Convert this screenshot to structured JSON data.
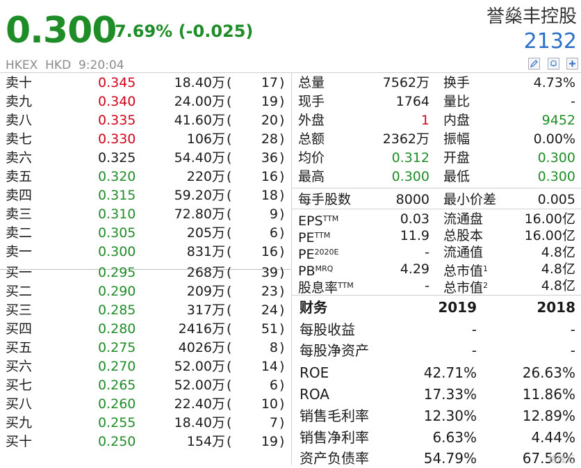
{
  "quote": {
    "price": "0.300",
    "change": "-7.69% (-0.025)",
    "exchange": "HKEX",
    "currency": "HKD",
    "time": "9:20:04",
    "name": "誉燊丰控股",
    "code": "2132"
  },
  "toolbar": {
    "icons": [
      "pencil-icon",
      "bell-icon",
      "plus-icon"
    ]
  },
  "colors": {
    "up": "#d0021b",
    "down": "#1e8c27",
    "neutral": "#1a1a1a",
    "code": "#2a6fc9"
  },
  "asks": [
    {
      "label": "卖十",
      "price": "0.345",
      "vol": "18.40万",
      "count": "17",
      "tone": "up"
    },
    {
      "label": "卖九",
      "price": "0.340",
      "vol": "24.00万",
      "count": "19",
      "tone": "up"
    },
    {
      "label": "卖八",
      "price": "0.335",
      "vol": "41.60万",
      "count": "20",
      "tone": "up"
    },
    {
      "label": "卖七",
      "price": "0.330",
      "vol": "106万",
      "count": "28",
      "tone": "up"
    },
    {
      "label": "卖六",
      "price": "0.325",
      "vol": "54.40万",
      "count": "36",
      "tone": "neutral"
    },
    {
      "label": "卖五",
      "price": "0.320",
      "vol": "220万",
      "count": "16",
      "tone": "down"
    },
    {
      "label": "卖四",
      "price": "0.315",
      "vol": "59.20万",
      "count": "18",
      "tone": "down"
    },
    {
      "label": "卖三",
      "price": "0.310",
      "vol": "72.80万",
      "count": "9",
      "tone": "down"
    },
    {
      "label": "卖二",
      "price": "0.305",
      "vol": "205万",
      "count": "6",
      "tone": "down"
    },
    {
      "label": "卖一",
      "price": "0.300",
      "vol": "831万",
      "count": "16",
      "tone": "down"
    }
  ],
  "bids": [
    {
      "label": "买一",
      "price": "0.295",
      "vol": "268万",
      "count": "39",
      "tone": "down"
    },
    {
      "label": "买二",
      "price": "0.290",
      "vol": "209万",
      "count": "23",
      "tone": "down"
    },
    {
      "label": "买三",
      "price": "0.285",
      "vol": "317万",
      "count": "24",
      "tone": "down"
    },
    {
      "label": "买四",
      "price": "0.280",
      "vol": "2416万",
      "count": "51",
      "tone": "down"
    },
    {
      "label": "买五",
      "price": "0.275",
      "vol": "4026万",
      "count": "8",
      "tone": "down"
    },
    {
      "label": "买六",
      "price": "0.270",
      "vol": "52.00万",
      "count": "14",
      "tone": "down"
    },
    {
      "label": "买七",
      "price": "0.265",
      "vol": "52.00万",
      "count": "6",
      "tone": "down"
    },
    {
      "label": "买八",
      "price": "0.260",
      "vol": "22.40万",
      "count": "10",
      "tone": "down"
    },
    {
      "label": "买九",
      "price": "0.255",
      "vol": "18.40万",
      "count": "7",
      "tone": "down"
    },
    {
      "label": "买十",
      "price": "0.250",
      "vol": "154万",
      "count": "19",
      "tone": "down"
    }
  ],
  "stats": [
    {
      "l1": "总量",
      "v1": "7562万",
      "t1": "neutral",
      "l2": "换手",
      "v2": "4.73%",
      "t2": "neutral"
    },
    {
      "l1": "现手",
      "v1": "1764",
      "t1": "neutral",
      "l2": "量比",
      "v2": "-",
      "t2": "neutral"
    },
    {
      "l1": "外盘",
      "v1": "1",
      "t1": "up",
      "l2": "内盘",
      "v2": "9452",
      "t2": "down"
    },
    {
      "l1": "总额",
      "v1": "2362万",
      "t1": "neutral",
      "l2": "振幅",
      "v2": "0.00%",
      "t2": "neutral"
    },
    {
      "l1": "均价",
      "v1": "0.312",
      "t1": "down",
      "l2": "开盘",
      "v2": "0.300",
      "t2": "down"
    },
    {
      "l1": "最高",
      "v1": "0.300",
      "t1": "down",
      "l2": "最低",
      "v2": "0.300",
      "t2": "down"
    }
  ],
  "lot": {
    "l1": "每手股数",
    "v1": "8000",
    "l2": "最小价差",
    "v2": "0.005"
  },
  "valuation": [
    {
      "l1": "EPS",
      "sup1": "TTM",
      "v1": "0.03",
      "l2": "流通盘",
      "sup2": "",
      "v2": "16.00亿"
    },
    {
      "l1": "PE",
      "sup1": "TTM",
      "v1": "11.9",
      "l2": "总股本",
      "sup2": "",
      "v2": "16.00亿"
    },
    {
      "l1": "PE",
      "sup1": "2020E",
      "v1": "-",
      "l2": "流通值",
      "sup2": "",
      "v2": "4.8亿"
    },
    {
      "l1": "PB",
      "sup1": "MRQ",
      "v1": "4.29",
      "l2": "总市值",
      "sup2": "1",
      "v2": "4.8亿"
    },
    {
      "l1": "股息率",
      "sup1": "TTM",
      "v1": "-",
      "l2": "总市值",
      "sup2": "2",
      "v2": "4.8亿"
    }
  ],
  "finance": {
    "title": "财务",
    "col1": "2019",
    "col2": "2018",
    "rows": [
      {
        "label": "每股收益",
        "v1": "-",
        "v2": "-"
      },
      {
        "label": "每股净资产",
        "v1": "-",
        "v2": "-"
      },
      {
        "label": "ROE",
        "v1": "42.71%",
        "v2": "26.63%"
      },
      {
        "label": "ROA",
        "v1": "17.33%",
        "v2": "11.86%"
      },
      {
        "label": "销售毛利率",
        "v1": "12.30%",
        "v2": "12.89%"
      },
      {
        "label": "销售净利率",
        "v1": "6.63%",
        "v2": "4.44%"
      },
      {
        "label": "资产负债率",
        "v1": "54.79%",
        "v2": "67.56%"
      }
    ]
  },
  "watermark": "格隆汇"
}
